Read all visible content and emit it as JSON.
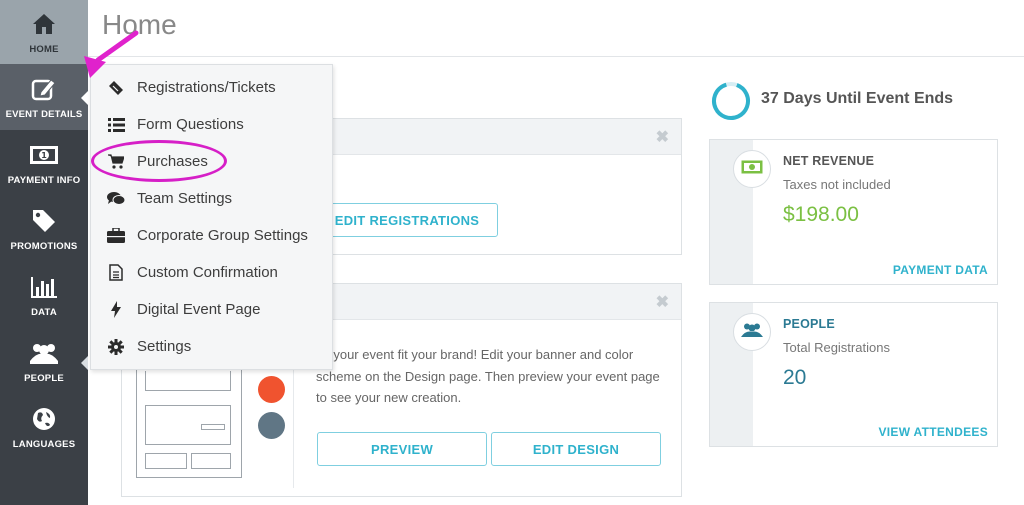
{
  "sidebar": {
    "items": [
      {
        "label": "HOME",
        "icon": "home-icon"
      },
      {
        "label": "EVENT DETAILS",
        "icon": "edit-icon"
      },
      {
        "label": "PAYMENT INFO",
        "icon": "money-icon"
      },
      {
        "label": "PROMOTIONS",
        "icon": "tag-icon"
      },
      {
        "label": "DATA",
        "icon": "bar-chart-icon"
      },
      {
        "label": "PEOPLE",
        "icon": "users-icon"
      },
      {
        "label": "LANGUAGES",
        "icon": "globe-icon"
      }
    ]
  },
  "header": {
    "title": "Home"
  },
  "menu": {
    "items": [
      {
        "label": "Registrations/Tickets",
        "icon": "ticket-icon"
      },
      {
        "label": "Form Questions",
        "icon": "list-icon"
      },
      {
        "label": "Purchases",
        "icon": "cart-icon"
      },
      {
        "label": "Team Settings",
        "icon": "comments-icon"
      },
      {
        "label": "Corporate Group Settings",
        "icon": "briefcase-icon"
      },
      {
        "label": "Custom Confirmation",
        "icon": "document-icon"
      },
      {
        "label": "Digital Event Page",
        "icon": "bolt-icon"
      },
      {
        "label": "Settings",
        "icon": "gear-icon"
      }
    ]
  },
  "registrations_card": {
    "button_label": "EDIT REGISTRATIONS"
  },
  "design_card": {
    "text": "ke your event fit your brand! Edit your banner and color scheme on the Design page. Then preview your event page to see your new creation.",
    "preview_label": "PREVIEW",
    "edit_design_label": "EDIT DESIGN"
  },
  "countdown": {
    "text": "37 Days Until Event Ends"
  },
  "revenue": {
    "title": "NET REVENUE",
    "subtitle": "Taxes not included",
    "value": "$198.00",
    "link": "PAYMENT DATA"
  },
  "people": {
    "title": "PEOPLE",
    "subtitle": "Total Registrations",
    "value": "20",
    "link": "VIEW ATTENDEES"
  },
  "colors": {
    "accent": "#2fb2cc",
    "highlight": "#d61fc7",
    "revenue_green": "#7bc043",
    "orange_dot": "#f0532f",
    "slate_dot": "#607685"
  }
}
